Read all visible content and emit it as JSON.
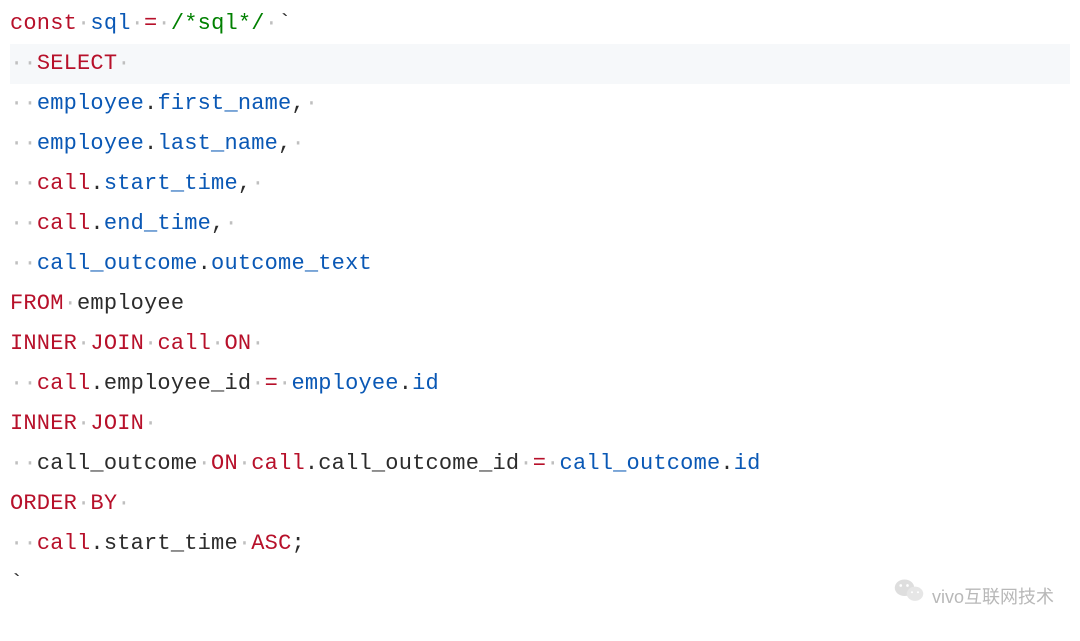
{
  "code": {
    "l1_const": "const",
    "l1_sql": "sql",
    "l1_eq": "=",
    "l1_comment": "/*sql*/",
    "l1_tick": "`",
    "l2_select": "SELECT",
    "l3_tbl": "employee",
    "l3_col": "first_name",
    "l4_tbl": "employee",
    "l4_col": "last_name",
    "l5_tbl": "call",
    "l5_col": "start_time",
    "l6_tbl": "call",
    "l6_col": "end_time",
    "l7_tbl": "call_outcome",
    "l7_col": "outcome_text",
    "l8_from": "FROM",
    "l8_tbl": "employee",
    "l9_inner": "INNER",
    "l9_join": "JOIN",
    "l9_tbl": "call",
    "l9_on": "ON",
    "l10_tbl1": "call",
    "l10_col1": "employee_id",
    "l10_eq": "=",
    "l10_tbl2": "employee",
    "l10_col2": "id",
    "l11_inner": "INNER",
    "l11_join": "JOIN",
    "l12_tbl1": "call_outcome",
    "l12_on": "ON",
    "l12_tbl2": "call",
    "l12_col2": "call_outcome_id",
    "l12_eq": "=",
    "l12_tbl3": "call_outcome",
    "l12_col3": "id",
    "l13_order": "ORDER",
    "l13_by": "BY",
    "l14_tbl": "call",
    "l14_col": "start_time",
    "l14_asc": "ASC",
    "l14_semi": ";",
    "l15_tick": "`"
  },
  "watermark": {
    "text": "vivo互联网技术"
  },
  "dot": "·",
  "comma": ",",
  "period": "."
}
